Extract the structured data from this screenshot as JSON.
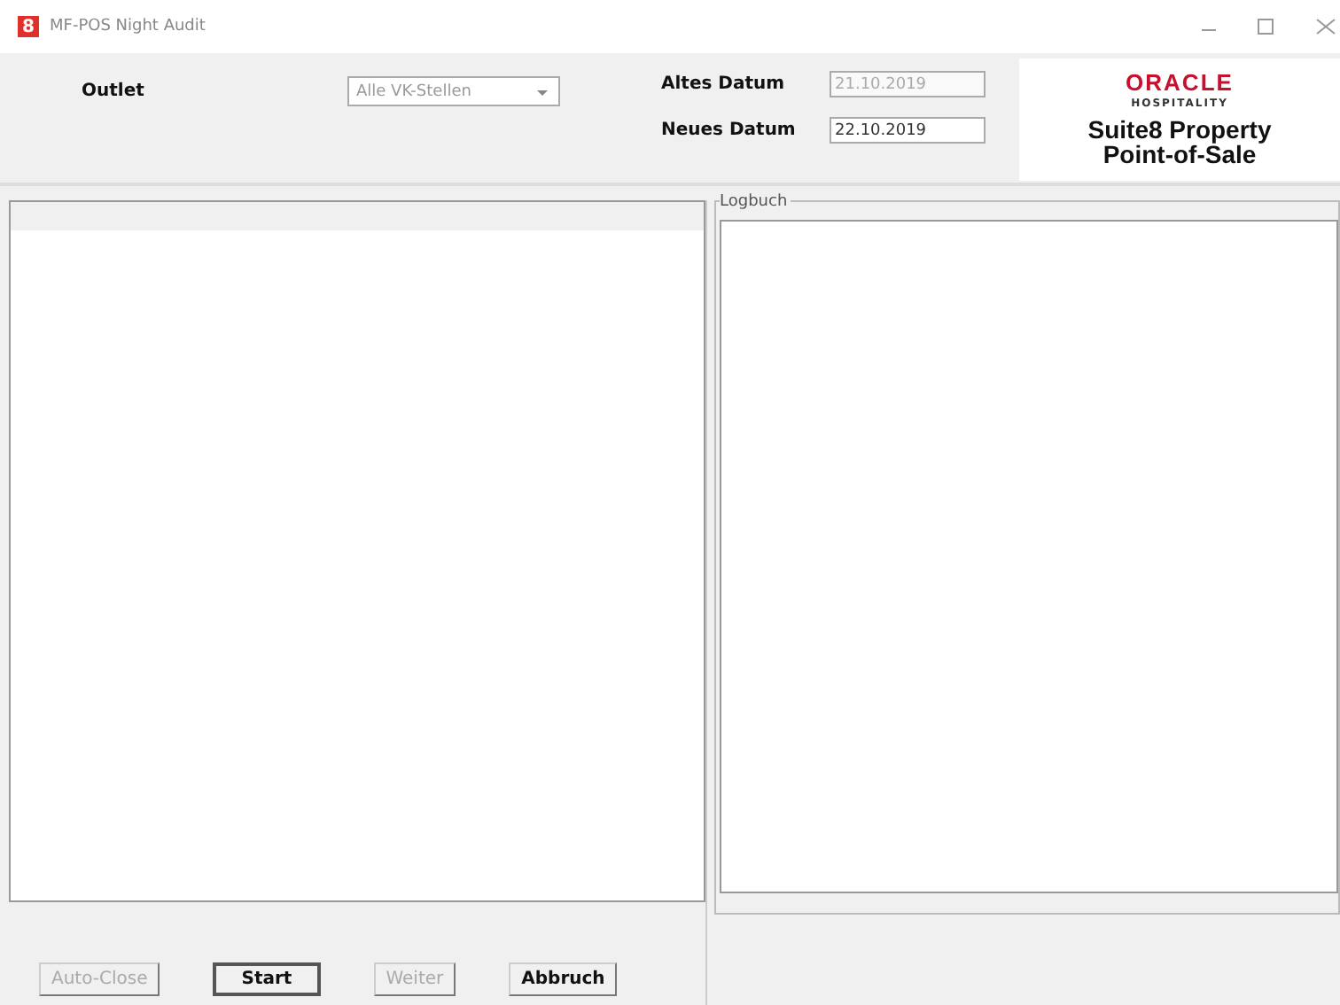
{
  "window": {
    "title": "MF-POS Night Audit",
    "app_icon": "8"
  },
  "header": {
    "outlet_label": "Outlet",
    "outlet_value": "Alle VK-Stellen",
    "old_date_label": "Altes Datum",
    "old_date": "21.10.2019",
    "new_date_label": "Neues Datum",
    "new_date": "22.10.2019"
  },
  "logo": {
    "brand": "ORACLE",
    "sub": "HOSPITALITY",
    "line1": "Suite8 Property",
    "line2": "Point-of-Sale"
  },
  "log": {
    "title": "Logbuch"
  },
  "buttons": [
    {
      "label": "Auto-Close",
      "disabled": true,
      "focused": false
    },
    {
      "label": "Start",
      "disabled": false,
      "focused": true
    },
    {
      "label": "Weiter",
      "disabled": true,
      "focused": false
    },
    {
      "label": "Abbruch",
      "disabled": false,
      "focused": false
    }
  ]
}
